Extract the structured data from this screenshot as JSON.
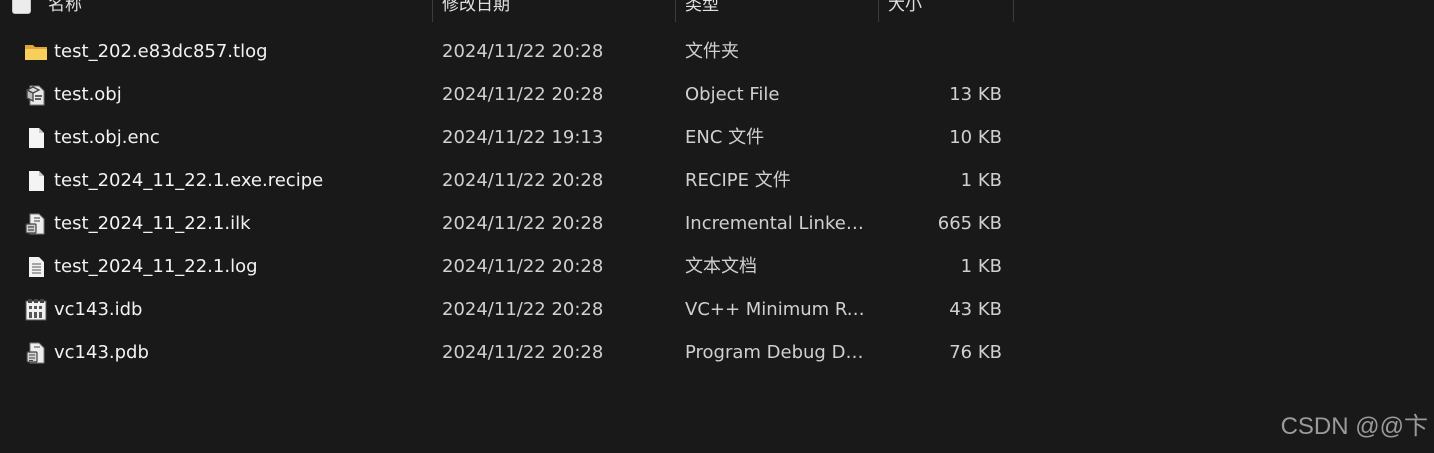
{
  "header": {
    "name": "名称",
    "date": "修改日期",
    "type": "类型",
    "size": "大小"
  },
  "files": [
    {
      "icon": "folder-icon",
      "name": "test_202.e83dc857.tlog",
      "date": "2024/11/22 20:28",
      "type": "文件夹",
      "size": ""
    },
    {
      "icon": "object-file-icon",
      "name": "test.obj",
      "date": "2024/11/22 20:28",
      "type": "Object File",
      "size": "13 KB"
    },
    {
      "icon": "blank-file-icon",
      "name": "test.obj.enc",
      "date": "2024/11/22 19:13",
      "type": "ENC 文件",
      "size": "10 KB"
    },
    {
      "icon": "blank-file-icon",
      "name": "test_2024_11_22.1.exe.recipe",
      "date": "2024/11/22 20:28",
      "type": "RECIPE 文件",
      "size": "1 KB"
    },
    {
      "icon": "linker-file-icon",
      "name": "test_2024_11_22.1.ilk",
      "date": "2024/11/22 20:28",
      "type": "Incremental Linker ...",
      "size": "665 KB"
    },
    {
      "icon": "text-file-icon",
      "name": "test_2024_11_22.1.log",
      "date": "2024/11/22 20:28",
      "type": "文本文档",
      "size": "1 KB"
    },
    {
      "icon": "idb-file-icon",
      "name": "vc143.idb",
      "date": "2024/11/22 20:28",
      "type": "VC++ Minimum Re...",
      "size": "43 KB"
    },
    {
      "icon": "pdb-file-icon",
      "name": "vc143.pdb",
      "date": "2024/11/22 20:28",
      "type": "Program Debug Da...",
      "size": "76 KB"
    }
  ],
  "watermark": "CSDN @@卞"
}
